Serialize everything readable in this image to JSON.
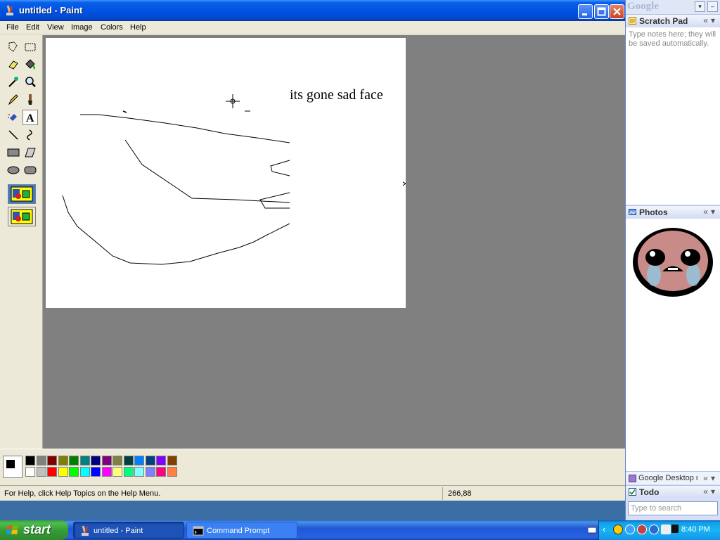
{
  "window": {
    "title": "untitled - Paint"
  },
  "menu": {
    "items": [
      "File",
      "Edit",
      "View",
      "Image",
      "Colors",
      "Help"
    ]
  },
  "canvas": {
    "text": "its gone sad face"
  },
  "palette": {
    "top_row": [
      "#000000",
      "#808080",
      "#800000",
      "#808000",
      "#008000",
      "#008080",
      "#000080",
      "#800080",
      "#808040",
      "#004040",
      "#0080ff",
      "#004080",
      "#8000ff",
      "#804000"
    ],
    "bottom_row": [
      "#ffffff",
      "#c0c0c0",
      "#ff0000",
      "#ffff00",
      "#00ff00",
      "#00ffff",
      "#0000ff",
      "#ff00ff",
      "#ffff80",
      "#00ff80",
      "#80ffff",
      "#8080ff",
      "#ff0080",
      "#ff8040"
    ],
    "foreground": "#000000",
    "background": "#ffffff"
  },
  "status": {
    "help": "For Help, click Help Topics on the Help Menu.",
    "coords": "266,88"
  },
  "sidebar": {
    "logo": "Google",
    "scratch_pad": {
      "title": "Scratch Pad",
      "hint": "Type notes here; they will be saved automatically."
    },
    "photos": {
      "title": "Photos"
    },
    "google_desktop": {
      "label": "Google Desktop r"
    },
    "todo": {
      "title": "Todo"
    },
    "search": {
      "placeholder": "Type to search"
    }
  },
  "taskbar": {
    "start_label": "start",
    "tasks": [
      {
        "label": "untitled - Paint"
      },
      {
        "label": "Command Prompt"
      }
    ],
    "clock": "8:40 PM"
  }
}
